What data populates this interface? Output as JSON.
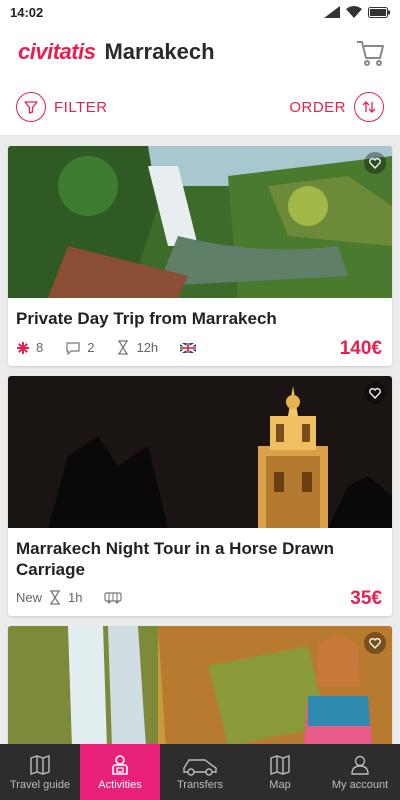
{
  "status": {
    "time": "14:02"
  },
  "header": {
    "brand": "civitatis",
    "city": "Marrakech"
  },
  "toolbar": {
    "filter_label": "FILTER",
    "order_label": "ORDER"
  },
  "cards": [
    {
      "title": "Private Day Trip from Marrakech",
      "rating": "8",
      "comments": "2",
      "duration": "12h",
      "price": "140€"
    },
    {
      "title": "Marrakech Night Tour in a Horse Drawn Carriage",
      "badge": "New",
      "duration": "1h",
      "price": "35€"
    },
    {
      "title": ""
    }
  ],
  "tabs": [
    {
      "label": "Travel guide",
      "icon": "map-book-icon"
    },
    {
      "label": "Activities",
      "icon": "activities-icon"
    },
    {
      "label": "Transfers",
      "icon": "car-icon"
    },
    {
      "label": "Map",
      "icon": "map-icon"
    },
    {
      "label": "My account",
      "icon": "user-icon"
    }
  ],
  "colors": {
    "accent": "#e8204f",
    "active_tab": "#e8207a",
    "tabbar": "#2d2d2d"
  }
}
